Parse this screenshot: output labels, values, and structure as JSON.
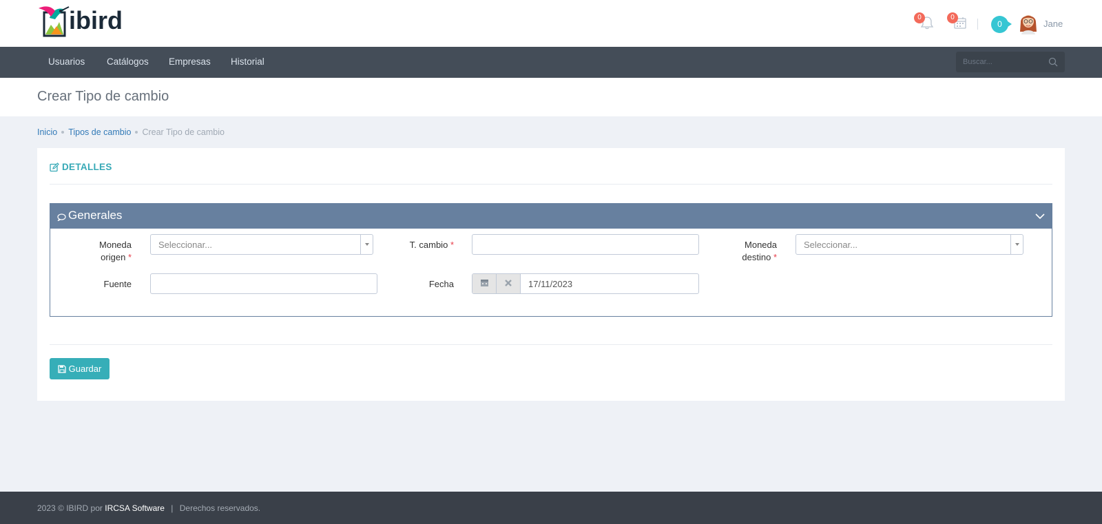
{
  "brand": {
    "name": "ibird"
  },
  "header": {
    "notifications_count": "0",
    "calendar_count": "0",
    "messages_count": "0",
    "user_name": "Jane"
  },
  "nav": {
    "items": [
      {
        "label": "Usuarios"
      },
      {
        "label": "Catálogos"
      },
      {
        "label": "Empresas"
      },
      {
        "label": "Historial"
      }
    ],
    "search_placeholder": "Buscar..."
  },
  "page": {
    "title": "Crear Tipo de cambio"
  },
  "breadcrumb": {
    "items": [
      {
        "label": "Inicio"
      },
      {
        "label": "Tipos de cambio"
      },
      {
        "label": "Crear Tipo de cambio"
      }
    ]
  },
  "card": {
    "caption": "DETALLES",
    "section_title": "Generales",
    "fields": {
      "moneda_origen": {
        "label_line1": "Moneda",
        "label_line2": "origen",
        "required": "*",
        "placeholder": "Seleccionar..."
      },
      "t_cambio": {
        "label": "T. cambio",
        "required": "*",
        "value": ""
      },
      "moneda_destino": {
        "label_line1": "Moneda",
        "label_line2": "destino",
        "required": "*",
        "placeholder": "Seleccionar..."
      },
      "fuente": {
        "label": "Fuente",
        "value": ""
      },
      "fecha": {
        "label": "Fecha",
        "value": "17/11/2023"
      }
    },
    "save_label": "Guardar"
  },
  "footer": {
    "prefix": "2023 © IBIRD por",
    "company": "IRCSA Software",
    "separator": "|",
    "rights": "Derechos reservados."
  },
  "colors": {
    "accent": "#36aeb8",
    "nav_bg": "#444d58",
    "portlet_head": "#67809f",
    "badge": "#f36a5a"
  }
}
